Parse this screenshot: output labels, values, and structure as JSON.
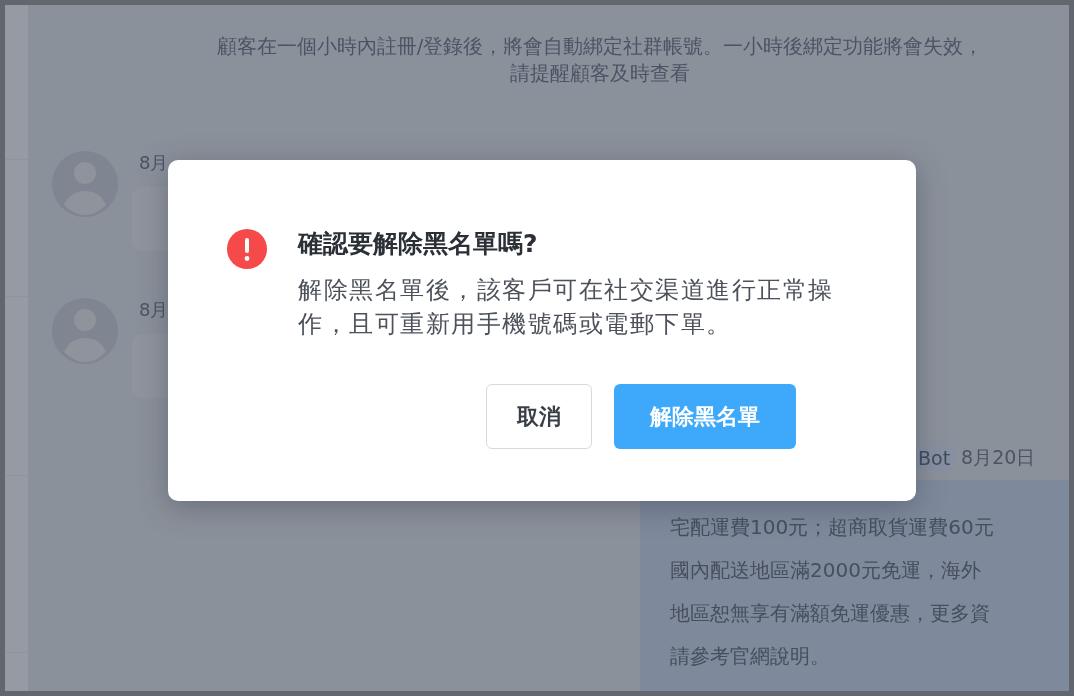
{
  "notice": "顧客在一個小時內註冊/登錄後，將會自動綁定社群帳號。一小時後綁定功能將會失效，請提醒顧客及時查看",
  "messages": [
    {
      "date": "8月"
    },
    {
      "date": "8月"
    }
  ],
  "bot_message": {
    "tag": "Bot",
    "date": "8月20日",
    "lines": [
      "宅配運費100元；超商取貨運費60元",
      "國內配送地區滿2000元免運，海外",
      "地區恕無享有滿額免運優惠，更多資",
      "請參考官網說明。"
    ]
  },
  "dialog": {
    "title": "確認要解除黑名單嗎?",
    "body": "解除黑名單後，該客戶可在社交渠道進行正常操作，且可重新用手機號碼或電郵下單。",
    "buttons": [
      {
        "label": "取消",
        "kind": "secondary"
      },
      {
        "label": "解除黑名單",
        "kind": "primary"
      }
    ]
  }
}
